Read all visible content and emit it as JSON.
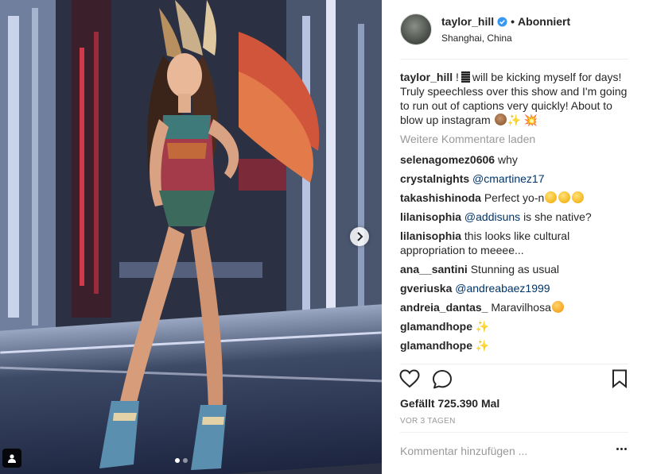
{
  "post": {
    "username": "taylor_hill",
    "follow_status": "Abonniert",
    "separator": "•",
    "location": "Shanghai, China"
  },
  "caption": {
    "username": "taylor_hill",
    "text_part1": "!",
    "text_part2": "will be kicking myself for days! Truly speechless over this show and I'm going to run out of captions very quickly! About to blow up instagram"
  },
  "load_more": "Weitere Kommentare laden",
  "comments": [
    {
      "user": "selenagomez0606",
      "text": "why"
    },
    {
      "user": "crystalnights",
      "mention": "@cmartinez17",
      "text": ""
    },
    {
      "user": "takashishinoda",
      "text": "Perfect yo-n"
    },
    {
      "user": "lilanisophia",
      "mention": "@addisuns",
      "text": "is she native?"
    },
    {
      "user": "lilanisophia",
      "text": "this looks like cultural appropriation to meeee..."
    },
    {
      "user": "ana__santini",
      "text": "Stunning as usual"
    },
    {
      "user": "gveriuska",
      "mention": "@andreabaez1999",
      "text": ""
    },
    {
      "user": "andreia_dantas_",
      "text": "Maravilhosa"
    },
    {
      "user": "glamandhope",
      "text": ""
    },
    {
      "user": "glamandhope",
      "text": ""
    }
  ],
  "likes_text": "Gefällt 725.390 Mal",
  "time_text": "VOR 3 TAGEN",
  "comment_placeholder": "Kommentar hinzufügen ...",
  "icons": {
    "like": "heart-icon",
    "comment": "comment-icon",
    "save": "bookmark-icon",
    "more": "more-options-icon",
    "next": "chevron-right-icon",
    "tag": "user-tag-icon",
    "verified": "verified-badge-icon"
  },
  "colors": {
    "mention": "#003569",
    "verified": "#3897f0",
    "muted": "#999999"
  }
}
